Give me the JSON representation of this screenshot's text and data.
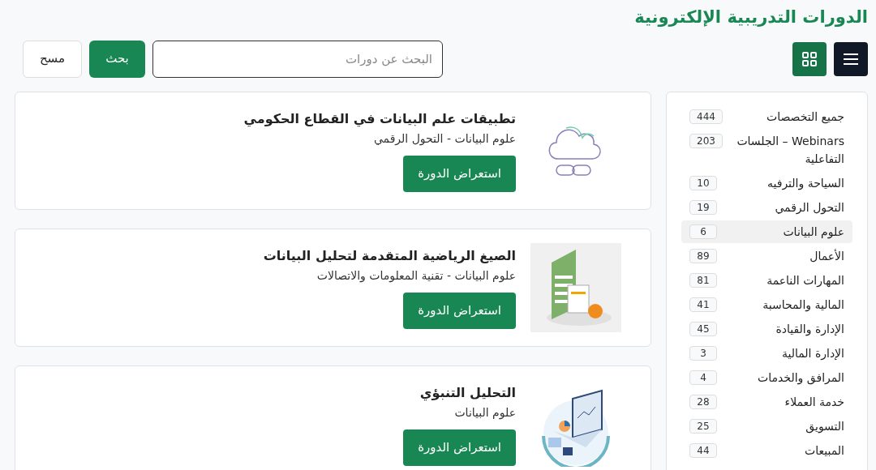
{
  "page_title": "الدورات التدريبية الإلكترونية",
  "toolbar": {
    "search": {
      "placeholder": "البحث عن دورات"
    },
    "search_button": "بحث",
    "clear_button": "مسح"
  },
  "categories": [
    {
      "name": "جميع التخصصات",
      "count": "444",
      "selected": false
    },
    {
      "name": "Webinars – الجلسات التفاعلية",
      "count": "203",
      "selected": false
    },
    {
      "name": "السياحة والترفيه",
      "count": "10",
      "selected": false
    },
    {
      "name": "التحول الرقمي",
      "count": "19",
      "selected": false
    },
    {
      "name": "علوم البيانات",
      "count": "6",
      "selected": true
    },
    {
      "name": "الأعمال",
      "count": "89",
      "selected": false
    },
    {
      "name": "المهارات الناعمة",
      "count": "81",
      "selected": false
    },
    {
      "name": "المالية والمحاسبة",
      "count": "41",
      "selected": false
    },
    {
      "name": "الإدارة والقيادة",
      "count": "45",
      "selected": false
    },
    {
      "name": "الإدارة المالية",
      "count": "3",
      "selected": false
    },
    {
      "name": "المرافق والخدمات",
      "count": "4",
      "selected": false
    },
    {
      "name": "خدمة العملاء",
      "count": "28",
      "selected": false
    },
    {
      "name": "التسويق",
      "count": "25",
      "selected": false
    },
    {
      "name": "المبيعات",
      "count": "44",
      "selected": false
    }
  ],
  "courses": [
    {
      "kind": "cloud",
      "title": "تطبيقات علم البيانات في القطاع الحكومي",
      "subtitle": "علوم البيانات - التحول الرقمي",
      "button": "استعراض الدورة"
    },
    {
      "kind": "spreadsheet",
      "title": "الصيغ الرياضية المتقدمة لتحليل البيانات",
      "subtitle": "علوم البيانات - تقنية المعلومات والاتصالات",
      "button": "استعراض الدورة"
    },
    {
      "kind": "laptop",
      "title": "التحليل التنبؤي",
      "subtitle": "علوم البيانات",
      "button": "استعراض الدورة"
    }
  ]
}
